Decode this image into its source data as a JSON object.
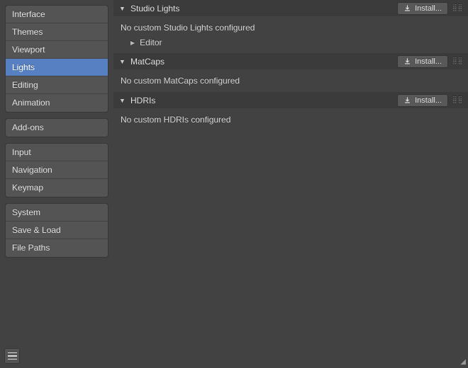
{
  "sidebar": {
    "groups": [
      [
        "Interface",
        "Themes",
        "Viewport",
        "Lights",
        "Editing",
        "Animation"
      ],
      [
        "Add-ons"
      ],
      [
        "Input",
        "Navigation",
        "Keymap"
      ],
      [
        "System",
        "Save & Load",
        "File Paths"
      ]
    ],
    "active": "Lights"
  },
  "panels": [
    {
      "title": "Studio Lights",
      "install": "Install...",
      "msg": "No custom Studio Lights configured",
      "editor": "Editor"
    },
    {
      "title": "MatCaps",
      "install": "Install...",
      "msg": "No custom MatCaps configured"
    },
    {
      "title": "HDRIs",
      "install": "Install...",
      "msg": "No custom HDRIs configured"
    }
  ]
}
